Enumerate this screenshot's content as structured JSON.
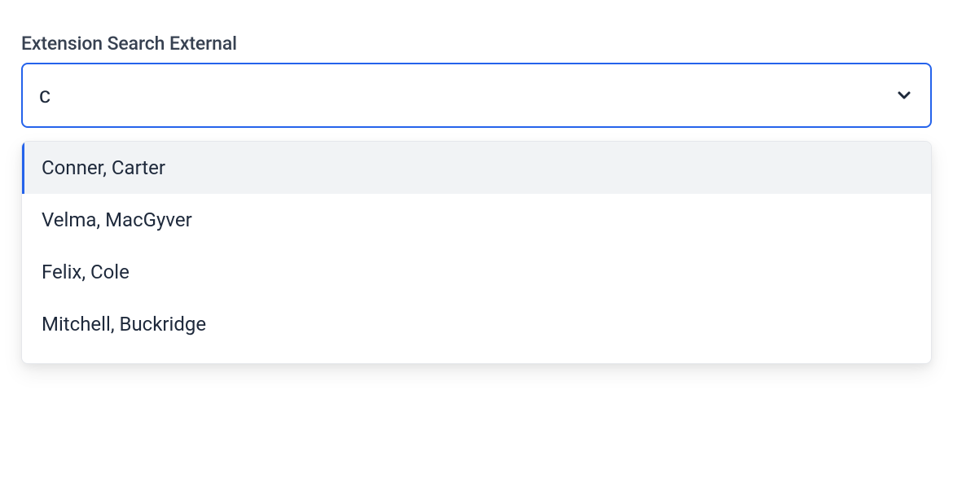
{
  "field": {
    "label": "Extension Search External",
    "value": "c",
    "options": [
      {
        "label": "Conner, Carter",
        "highlighted": true
      },
      {
        "label": "Velma, MacGyver",
        "highlighted": false
      },
      {
        "label": "Felix, Cole",
        "highlighted": false
      },
      {
        "label": "Mitchell, Buckridge",
        "highlighted": false
      }
    ]
  }
}
